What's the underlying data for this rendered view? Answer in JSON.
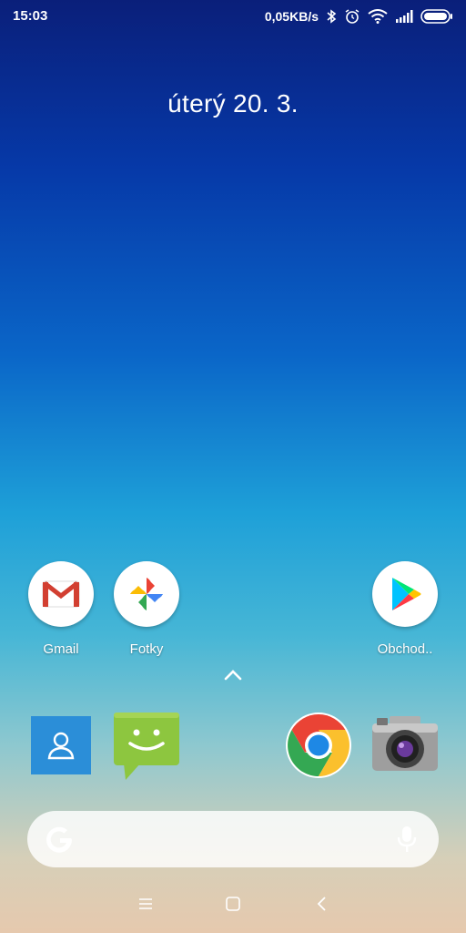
{
  "status_bar": {
    "time": "15:03",
    "net_speed": "0,05KB/s",
    "icons": [
      "bluetooth-icon",
      "alarm-icon",
      "wifi-icon",
      "signal-icon",
      "battery-icon"
    ]
  },
  "date": "úterý 20. 3.",
  "apps": [
    {
      "name": "gmail",
      "label": "Gmail"
    },
    {
      "name": "photos",
      "label": "Fotky"
    },
    {
      "name": "play-store",
      "label": "Obchod.."
    }
  ],
  "dock": [
    "contacts",
    "messaging",
    "chrome",
    "camera"
  ],
  "search": {
    "icons": [
      "google-g-icon",
      "microphone-icon"
    ]
  },
  "nav": [
    "menu-icon",
    "home-icon",
    "back-icon"
  ],
  "colors": {
    "accent": "#ffffff"
  }
}
